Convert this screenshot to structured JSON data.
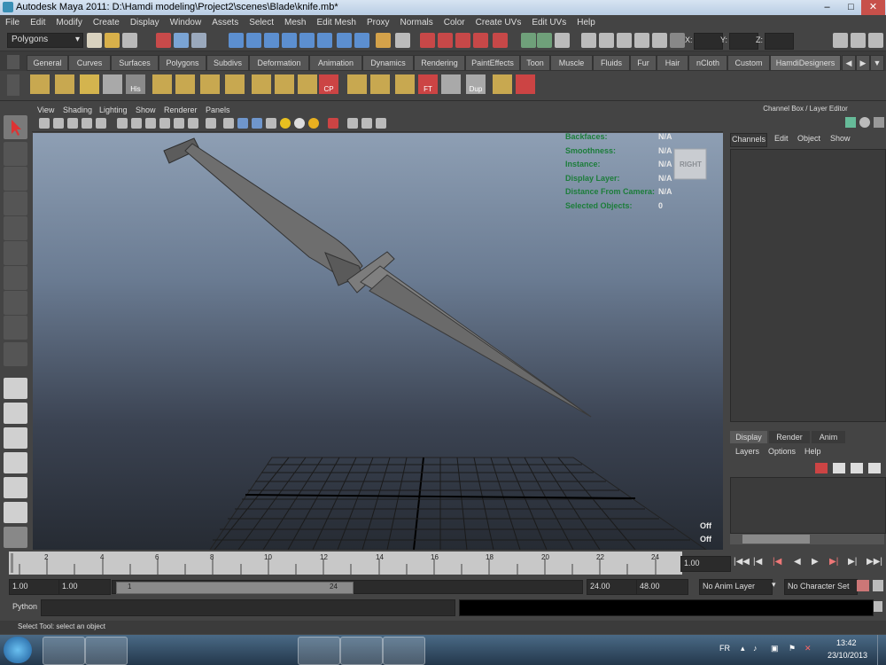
{
  "window": {
    "title": "Autodesk Maya 2011: D:\\Hamdi modeling\\Project2\\scenes\\Blade\\knife.mb*"
  },
  "menu": [
    "File",
    "Edit",
    "Modify",
    "Create",
    "Display",
    "Window",
    "Assets",
    "Select",
    "Mesh",
    "Edit Mesh",
    "Proxy",
    "Normals",
    "Color",
    "Create UVs",
    "Edit UVs",
    "Help"
  ],
  "status": {
    "mode": "Polygons",
    "x_label": "X:",
    "y_label": "Y:",
    "z_label": "Z:"
  },
  "shelf": {
    "tabs": [
      "General",
      "Curves",
      "Surfaces",
      "Polygons",
      "Subdivs",
      "Deformation",
      "Animation",
      "Dynamics",
      "Rendering",
      "PaintEffects",
      "Toon",
      "Muscle",
      "Fluids",
      "Fur",
      "Hair",
      "nCloth",
      "Custom",
      "HamdiDesigners"
    ],
    "active_tab": "HamdiDesigners",
    "icon_labels": {
      "his": "His",
      "cp": "CP",
      "ft": "FT",
      "dup": "Dup"
    }
  },
  "viewport": {
    "menu": [
      "View",
      "Shading",
      "Lighting",
      "Show",
      "Renderer",
      "Panels"
    ],
    "hud": [
      {
        "label": "Backfaces:",
        "value": "N/A"
      },
      {
        "label": "Smoothness:",
        "value": "N/A"
      },
      {
        "label": "Instance:",
        "value": "N/A"
      },
      {
        "label": "Display Layer:",
        "value": "N/A"
      },
      {
        "label": "Distance From Camera:",
        "value": "N/A"
      },
      {
        "label": "Selected Objects:",
        "value": "0"
      }
    ],
    "viewcube_label": "RIGHT",
    "corner_off_1": "Off",
    "corner_off_2": "Off"
  },
  "channel_box": {
    "title": "Channel Box / Layer Editor",
    "menu": [
      "Channels",
      "Edit",
      "Object",
      "Show"
    ],
    "layer_tabs": [
      "Display",
      "Render",
      "Anim"
    ],
    "layer_menu": [
      "Layers",
      "Options",
      "Help"
    ]
  },
  "timeline": {
    "ticks": [
      "2",
      "4",
      "6",
      "8",
      "10",
      "12",
      "14",
      "16",
      "18",
      "20",
      "22",
      "24"
    ],
    "current_frame": "1.00"
  },
  "range": {
    "start": "1.00",
    "start2": "1.00",
    "slider_start": "1",
    "slider_end": "24",
    "end": "24.00",
    "end2": "48.00",
    "anim_layer": "No Anim Layer",
    "char_set": "No Character Set"
  },
  "command": {
    "lang": "Python"
  },
  "help_line": "Select Tool: select an object",
  "taskbar": {
    "lang": "FR",
    "time": "13:42",
    "date": "23/10/2013"
  }
}
